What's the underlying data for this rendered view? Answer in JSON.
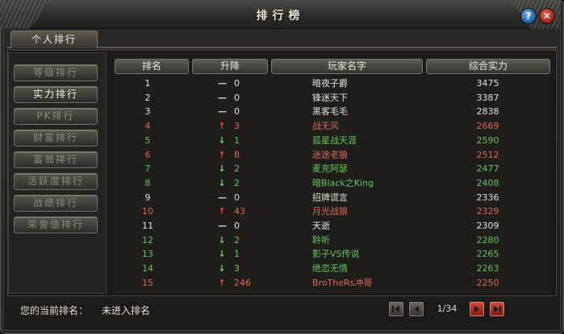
{
  "window": {
    "title": "排行榜"
  },
  "tab": {
    "label": "个人排行"
  },
  "categories": [
    {
      "label": "等级排行",
      "active": false
    },
    {
      "label": "实力排行",
      "active": true
    },
    {
      "label": "PK排行",
      "active": false
    },
    {
      "label": "财富排行",
      "active": false
    },
    {
      "label": "富翁排行",
      "active": false
    },
    {
      "label": "活跃度排行",
      "active": false
    },
    {
      "label": "战绩排行",
      "active": false
    },
    {
      "label": "荣誉值排行",
      "active": false
    }
  ],
  "table": {
    "headers": {
      "rank": "排名",
      "change": "升降",
      "name": "玩家名字",
      "power": "综合实力"
    },
    "rows": [
      {
        "rank": "1",
        "trend": "flat",
        "arrow": "—",
        "change": "0",
        "name": "暗夜子爵",
        "power": "3475",
        "color": "white"
      },
      {
        "rank": "2",
        "trend": "flat",
        "arrow": "—",
        "change": "0",
        "name": "锋迷天下",
        "power": "3387",
        "color": "white"
      },
      {
        "rank": "3",
        "trend": "flat",
        "arrow": "—",
        "change": "0",
        "name": "黑客毛毛",
        "power": "2838",
        "color": "white"
      },
      {
        "rank": "4",
        "trend": "up",
        "arrow": "↑",
        "change": "3",
        "name": "战无风",
        "power": "2669",
        "color": "red"
      },
      {
        "rank": "5",
        "trend": "down",
        "arrow": "↓",
        "change": "1",
        "name": "孤星战天涯",
        "power": "2590",
        "color": "green"
      },
      {
        "rank": "6",
        "trend": "up",
        "arrow": "↑",
        "change": "8",
        "name": "迷途老狼",
        "power": "2512",
        "color": "red"
      },
      {
        "rank": "7",
        "trend": "down",
        "arrow": "↓",
        "change": "2",
        "name": "麦克阿瑟",
        "power": "2477",
        "color": "green"
      },
      {
        "rank": "8",
        "trend": "down",
        "arrow": "↓",
        "change": "2",
        "name": "暗Black之King",
        "power": "2408",
        "color": "green"
      },
      {
        "rank": "9",
        "trend": "flat",
        "arrow": "—",
        "change": "0",
        "name": "招牌谎言",
        "power": "2336",
        "color": "white"
      },
      {
        "rank": "10",
        "trend": "up",
        "arrow": "↑",
        "change": "43",
        "name": "月光战狼",
        "power": "2329",
        "color": "red"
      },
      {
        "rank": "11",
        "trend": "flat",
        "arrow": "—",
        "change": "0",
        "name": "天逝",
        "power": "2309",
        "color": "white"
      },
      {
        "rank": "12",
        "trend": "down",
        "arrow": "↓",
        "change": "2",
        "name": "聆听",
        "power": "2280",
        "color": "green"
      },
      {
        "rank": "13",
        "trend": "down",
        "arrow": "↓",
        "change": "1",
        "name": "影子VS传说",
        "power": "2265",
        "color": "green"
      },
      {
        "rank": "14",
        "trend": "down",
        "arrow": "↓",
        "change": "3",
        "name": "绝恋无情",
        "power": "2263",
        "color": "green"
      },
      {
        "rank": "15",
        "trend": "up",
        "arrow": "↑",
        "change": "246",
        "name": "BroTheRs冲哥",
        "power": "2250",
        "color": "red"
      }
    ]
  },
  "footer": {
    "current_rank_label": "您的当前排名：",
    "current_rank_value": "未进入排名",
    "page_indicator": "1/34"
  },
  "colors": {
    "white": "#e6e2d8",
    "red": "#d9685c",
    "green": "#66c460",
    "accent_red": "#c0392b"
  },
  "icons": [
    "help-icon",
    "close-icon",
    "first-page-icon",
    "prev-page-icon",
    "next-page-icon",
    "last-page-icon"
  ]
}
